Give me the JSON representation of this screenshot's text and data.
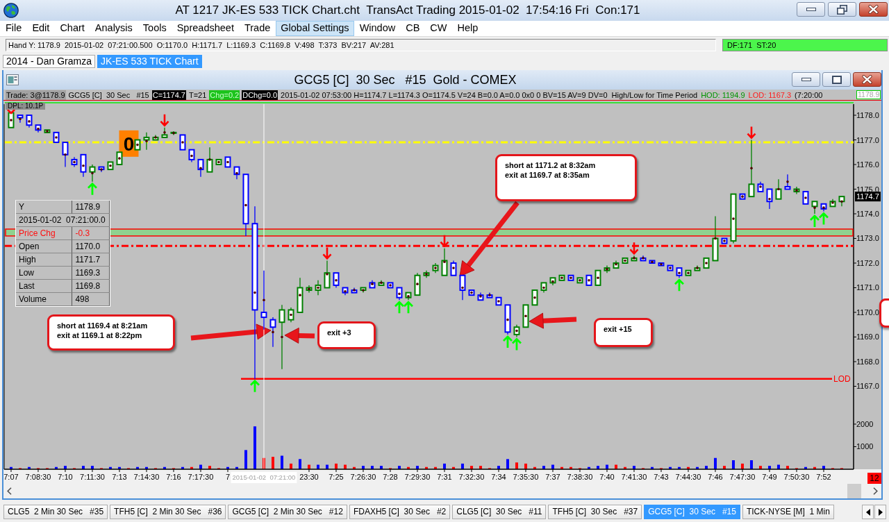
{
  "window": {
    "title": "AT 1217 JK-ES 533 TICK Chart.cht  TransAct Trading 2015-01-02  17:54:16 Fri  Con:171"
  },
  "menu": [
    {
      "label": "File",
      "selected": false
    },
    {
      "label": "Edit",
      "selected": false
    },
    {
      "label": "Chart",
      "selected": false
    },
    {
      "label": "Analysis",
      "selected": false
    },
    {
      "label": "Tools",
      "selected": false
    },
    {
      "label": "Spreadsheet",
      "selected": false
    },
    {
      "label": "Trade",
      "selected": false
    },
    {
      "label": "Global Settings",
      "selected": true
    },
    {
      "label": "Window",
      "selected": false
    },
    {
      "label": "CB",
      "selected": false
    },
    {
      "label": "CW",
      "selected": false
    },
    {
      "label": "Help",
      "selected": false
    }
  ],
  "quote_bar": {
    "text": "Hand Y: 1178.9  2015-01-02  07:21:00.500  O:1170.0  H:1171.7  L:1169.3  C:1169.8  V:498  T:373  BV:217  AV:281",
    "status": "DF:171  ST:20"
  },
  "workspace_tabs": [
    {
      "label": "2014 - Dan Gramza",
      "selected": false
    },
    {
      "label": "JK-ES 533 TICK Chart",
      "selected": true
    }
  ],
  "chart_window": {
    "title": "GCG5 [C]  30 Sec   #15  Gold - COMEX",
    "readouts": [
      {
        "text": "Trade: 3@1178.9",
        "kind": "muted"
      },
      {
        "text": "GCG5 [C]  30 Sec   #15",
        "kind": "plain"
      },
      {
        "text": "C=1174.7",
        "kind": "inverse"
      },
      {
        "text": "T=21",
        "kind": "plain"
      },
      {
        "text": "Chg=0.2",
        "kind": "up"
      },
      {
        "text": "DChg=0.0",
        "kind": "inverse"
      },
      {
        "text": "2015-01-02 07:53:00 H=1174.7 L=1174.3 O=1174.5 V=24 B=0.0 A=0.0 0x0 0 BV=15 AV=9 DV=0  High/Low for Time Period",
        "kind": "plain"
      },
      {
        "text": "HOD: 1194.9",
        "kind": "high"
      },
      {
        "text": "LOD: 1167.3",
        "kind": "low"
      },
      {
        "text": "(7:20:00",
        "kind": "plain"
      }
    ],
    "cursor_price": "1178.9",
    "dpl_label": "DPL: 10.1P",
    "price_chart": {
      "chart_data": {
        "type": "candlestick",
        "ylim": [
          1165.915,
          1178.451
        ],
        "yticks": [
          {
            "value": 1167,
            "label": "1167.0"
          },
          {
            "value": 1168,
            "label": "1168.0"
          },
          {
            "value": 1169,
            "label": "1169.0"
          },
          {
            "value": 1170,
            "label": "1170.0"
          },
          {
            "value": 1171,
            "label": "1171.0"
          },
          {
            "value": 1172,
            "label": "1172.0"
          },
          {
            "value": 1173,
            "label": "1173.0"
          },
          {
            "value": 1174,
            "label": "1174.0"
          },
          {
            "value": 1175,
            "label": "1175.0"
          },
          {
            "value": 1176,
            "label": "1176.0"
          },
          {
            "value": 1177,
            "label": "1177.0"
          },
          {
            "value": 1178,
            "label": "1178.0"
          }
        ],
        "ohlc": [
          [
            1177.5,
            1178.1,
            1177.5,
            1178.1
          ],
          [
            1178.0,
            1178.0,
            1177.7,
            1177.9
          ],
          [
            1178.0,
            1178.0,
            1177.5,
            1177.6
          ],
          [
            1177.6,
            1177.6,
            1177.3,
            1177.4
          ],
          [
            1177.3,
            1177.4,
            1177.3,
            1177.4
          ],
          [
            1177.3,
            1177.3,
            1176.9,
            1176.9
          ],
          [
            1176.9,
            1176.9,
            1175.9,
            1176.4
          ],
          [
            1176.2,
            1176.3,
            1175.9,
            1176.0
          ],
          [
            1176.4,
            1176.4,
            1175.5,
            1175.7
          ],
          [
            1175.7,
            1176.0,
            1175.3,
            1175.9
          ],
          [
            1175.9,
            1175.9,
            1175.7,
            1175.8
          ],
          [
            1175.8,
            1176.1,
            1175.8,
            1176.1
          ],
          [
            1176.0,
            1176.5,
            1176.0,
            1176.5
          ],
          null,
          [
            1176.6,
            1177.0,
            1176.6,
            1177.0
          ],
          [
            1177.0,
            1177.3,
            1176.6,
            1177.1
          ],
          [
            1177.0,
            1177.2,
            1177.0,
            1177.1
          ],
          [
            1177.1,
            1177.5,
            1177.1,
            1177.2
          ],
          [
            1177.3,
            1177.35,
            1177.2,
            1177.3
          ],
          [
            1177.2,
            1177.2,
            1176.6,
            1176.6
          ],
          [
            1176.6,
            1176.6,
            1176.1,
            1176.2
          ],
          [
            1176.2,
            1176.2,
            1175.5,
            1175.8
          ],
          [
            1175.7,
            1176.7,
            1175.7,
            1176.2
          ],
          [
            1176.0,
            1176.2,
            1176.0,
            1176.2
          ],
          [
            1176.3,
            1176.3,
            1175.9,
            1175.9
          ],
          [
            1175.9,
            1175.9,
            1175.4,
            1175.6
          ],
          [
            1175.6,
            1175.6,
            1173.1,
            1173.6
          ],
          [
            1173.6,
            1174.3,
            1167.3,
            1170.1
          ],
          [
            1170.0,
            1171.7,
            1169.3,
            1169.8
          ],
          [
            1169.7,
            1169.8,
            1168.6,
            1169.4
          ],
          [
            1169.6,
            1170.3,
            1167.7,
            1170.1
          ],
          [
            1169.7,
            1170.2,
            1169.6,
            1170.1
          ],
          [
            1170.0,
            1171.4,
            1170.0,
            1171.0
          ],
          [
            1170.9,
            1171.1,
            1170.8,
            1171.0
          ],
          [
            1170.9,
            1171.3,
            1170.7,
            1171.1
          ],
          [
            1171.0,
            1172.1,
            1171.0,
            1171.6
          ],
          [
            1171.6,
            1171.6,
            1171.0,
            1171.1
          ],
          [
            1171.0,
            1171.0,
            1170.7,
            1170.8
          ],
          [
            1170.9,
            1171.0,
            1170.8,
            1170.8
          ],
          [
            1170.9,
            1171.0,
            1170.8,
            1171.0
          ],
          [
            1171.2,
            1171.3,
            1171.0,
            1171.0
          ],
          [
            1171.1,
            1171.3,
            1171.1,
            1171.2
          ],
          [
            1171.2,
            1171.2,
            1171.0,
            1171.0
          ],
          [
            1171.0,
            1171.0,
            1170.5,
            1170.6
          ],
          [
            1170.6,
            1170.8,
            1170.5,
            1170.8
          ],
          [
            1170.7,
            1171.6,
            1170.7,
            1171.5
          ],
          [
            1171.5,
            1171.7,
            1171.4,
            1171.6
          ],
          [
            1171.7,
            1172.0,
            1171.6,
            1171.9
          ],
          [
            1171.5,
            1172.6,
            1171.5,
            1172.1
          ],
          [
            1172.0,
            1172.1,
            1171.5,
            1171.5
          ],
          [
            1171.5,
            1171.5,
            1170.5,
            1170.9
          ],
          [
            1170.9,
            1170.9,
            1170.7,
            1170.7
          ],
          [
            1170.7,
            1170.8,
            1170.5,
            1170.5
          ],
          [
            1170.7,
            1170.8,
            1170.6,
            1170.6
          ],
          [
            1170.6,
            1170.6,
            1170.3,
            1170.3
          ],
          [
            1170.3,
            1170.3,
            1169.1,
            1169.2
          ],
          [
            1169.1,
            1169.5,
            1169.0,
            1169.4
          ],
          [
            1169.4,
            1170.3,
            1169.4,
            1170.3
          ],
          [
            1170.3,
            1170.9,
            1170.3,
            1170.9
          ],
          [
            1170.9,
            1171.2,
            1170.8,
            1171.2
          ],
          [
            1171.2,
            1171.4,
            1171.1,
            1171.4
          ],
          [
            1171.3,
            1171.5,
            1171.3,
            1171.5
          ],
          [
            1171.5,
            1171.5,
            1171.3,
            1171.3
          ],
          [
            1171.2,
            1171.4,
            1171.2,
            1171.4
          ],
          [
            1171.5,
            1171.5,
            1171.1,
            1171.1
          ],
          [
            1171.1,
            1171.7,
            1171.1,
            1171.7
          ],
          [
            1171.7,
            1171.9,
            1171.6,
            1171.8
          ],
          [
            1171.8,
            1172.1,
            1171.8,
            1172.0
          ],
          [
            1172.0,
            1172.2,
            1172.0,
            1172.2
          ],
          [
            1172.1,
            1172.3,
            1172.1,
            1172.2
          ],
          [
            1172.2,
            1172.3,
            1172.1,
            1172.1
          ],
          [
            1172.1,
            1172.1,
            1172.0,
            1172.0
          ],
          [
            1172.0,
            1172.0,
            1171.9,
            1171.9
          ],
          [
            1171.9,
            1171.9,
            1171.7,
            1171.7
          ],
          [
            1171.8,
            1171.8,
            1171.4,
            1171.5
          ],
          [
            1171.5,
            1171.7,
            1171.5,
            1171.7
          ],
          [
            1171.7,
            1171.9,
            1171.7,
            1171.8
          ],
          [
            1171.8,
            1172.2,
            1171.8,
            1172.2
          ],
          [
            1172.1,
            1173.9,
            1172.1,
            1173.0
          ],
          [
            1173.0,
            1173.0,
            1172.8,
            1172.8
          ],
          [
            1172.9,
            1174.8,
            1172.8,
            1174.8
          ],
          [
            1174.8,
            1174.8,
            1174.6,
            1174.6
          ],
          [
            1174.7,
            1177.0,
            1174.7,
            1175.2
          ],
          [
            1175.2,
            1175.3,
            1174.9,
            1174.9
          ],
          [
            1175.0,
            1175.0,
            1174.2,
            1174.5
          ],
          [
            1174.6,
            1175.4,
            1174.6,
            1175.0
          ],
          [
            1175.1,
            1175.6,
            1175.0,
            1175.0
          ],
          [
            1174.9,
            1175.1,
            1174.8,
            1175.0
          ],
          [
            1174.9,
            1174.9,
            1174.4,
            1174.4
          ],
          [
            1174.3,
            1174.5,
            1174.0,
            1174.5
          ],
          [
            1174.4,
            1174.4,
            1174.1,
            1174.2
          ],
          [
            1174.3,
            1174.6,
            1174.3,
            1174.5
          ],
          [
            1174.5,
            1174.7,
            1174.3,
            1174.7
          ]
        ],
        "ref_lines": [
          {
            "axis": "y",
            "value": 1176.9,
            "color": "#ffff00"
          },
          {
            "axis": "y",
            "value": 1172.7,
            "color": "#ff0000"
          },
          {
            "axis": "y",
            "value": 1167.3,
            "color": "#ff0000",
            "label": "LOD"
          }
        ],
        "bands": [
          {
            "axis": "y",
            "from": 1173.1,
            "to": 1173.38,
            "color": "#8fd18f"
          }
        ],
        "annotations": [
          {
            "text": "0",
            "y": 1176.85
          }
        ]
      },
      "last_price_label": "1174.7",
      "callouts": [
        {
          "lines": [
            "short at 1169.4 at 8:21am",
            "exit at 1169.1 at 8:22pm"
          ],
          "clipped": false
        },
        {
          "lines": [
            "exit +3"
          ],
          "clipped": false
        },
        {
          "lines": [
            "short at 1171.2 at 8:32am",
            "exit at 1169.7 at 8:35am"
          ],
          "clipped": false
        },
        {
          "lines": [
            "exit +15"
          ],
          "clipped": false
        },
        {
          "clipped": true
        }
      ]
    },
    "data_window": [
      {
        "kind": "field",
        "label": "Y",
        "value": "1178.9"
      },
      {
        "kind": "timestamp",
        "value": "2015-01-02  07:21:00.0"
      },
      {
        "kind": "change",
        "label": "Price Chg",
        "value": "-0.3"
      },
      {
        "kind": "field",
        "label": "Open",
        "value": "1170.0"
      },
      {
        "kind": "field",
        "label": "High",
        "value": "1171.7"
      },
      {
        "kind": "field",
        "label": "Low",
        "value": "1169.3"
      },
      {
        "kind": "field",
        "label": "Last",
        "value": "1169.8"
      },
      {
        "kind": "field",
        "label": "Volume",
        "value": "498"
      }
    ],
    "volume_chart": {
      "chart_data": {
        "type": "bar",
        "categories": [
          "7:07",
          null,
          null,
          "7:08:30",
          null,
          null,
          "7:10",
          null,
          null,
          "7:11:30",
          null,
          null,
          "7:13",
          null,
          null,
          "7:14:30",
          null,
          null,
          "7:16",
          null,
          null,
          "7:17:30",
          null,
          null,
          "7",
          null,
          null,
          null,
          null,
          null,
          null,
          null,
          null,
          "23:30",
          null,
          null,
          "7:25",
          null,
          null,
          "7:26:30",
          null,
          null,
          "7:28",
          null,
          null,
          "7:29:30",
          null,
          null,
          "7:31",
          null,
          null,
          "7:32:30",
          null,
          null,
          "7:34",
          null,
          null,
          "7:35:30",
          null,
          null,
          "7:37",
          null,
          null,
          "7:38:30",
          null,
          null,
          "7:40",
          null,
          null,
          "7:41:30",
          null,
          null,
          "7:43",
          null,
          null,
          "7:44:30",
          null,
          null,
          "7:46",
          null,
          null,
          "7:47:30",
          null,
          null,
          "7:49",
          null,
          null,
          "7:50:30",
          null,
          null,
          "7:52",
          null,
          null
        ],
        "ylim": [
          0,
          2492
        ],
        "yticks": [
          {
            "value": 1000,
            "label": "1000"
          },
          {
            "value": 2000,
            "label": "2000"
          }
        ],
        "series": [
          {
            "color": "#0000ff",
            "values": [
              100,
              null,
              100,
              null,
              null,
              100,
              150,
              null,
              150,
              150,
              null,
              100,
              100,
              null,
              100,
              100,
              null,
              100,
              null,
              100,
              null,
              200,
              null,
              null,
              100,
              100,
              850,
              1900,
              null,
              null,
              600,
              null,
              450,
              null,
              200,
              200,
              null,
              null,
              null,
              150,
              150,
              150,
              null,
              150,
              null,
              150,
              null,
              null,
              250,
              null,
              250,
              null,
              null,
              null,
              150,
              450,
              null,
              null,
              null,
              150,
              200,
              null,
              null,
              null,
              100,
              150,
              200,
              null,
              null,
              150,
              null,
              100,
              null,
              100,
              100,
              null,
              100,
              150,
              500,
              null,
              400,
              null,
              400,
              null,
              150,
              200,
              null,
              null,
              100,
              null,
              150,
              null,
              null
            ]
          },
          {
            "color": "#ff0000",
            "values": [
              null,
              50,
              null,
              50,
              50,
              null,
              null,
              50,
              null,
              null,
              50,
              null,
              null,
              50,
              null,
              null,
              50,
              null,
              50,
              null,
              100,
              null,
              150,
              50,
              null,
              null,
              null,
              null,
              500,
              550,
              null,
              250,
              null,
              200,
              null,
              null,
              250,
              200,
              100,
              null,
              null,
              null,
              50,
              null,
              100,
              null,
              100,
              100,
              null,
              100,
              null,
              150,
              150,
              50,
              null,
              null,
              300,
              250,
              100,
              null,
              null,
              100,
              100,
              50,
              null,
              null,
              null,
              200,
              100,
              null,
              50,
              null,
              50,
              null,
              null,
              100,
              null,
              null,
              null,
              150,
              null,
              250,
              null,
              150,
              null,
              null,
              150,
              50,
              null,
              100,
              null,
              50,
              50
            ]
          }
        ]
      }
    },
    "cursor_time_label": "2015-01-02  07:21:00",
    "count_badge": "12"
  },
  "chart_tabs": [
    {
      "label": "CLG5  2 Min 30 Sec   #35",
      "selected": false
    },
    {
      "label": "TFH5 [C]  2 Min 30 Sec   #36",
      "selected": false
    },
    {
      "label": "GCG5 [C]  2 Min 30 Sec   #12",
      "selected": false
    },
    {
      "label": "FDAXH5 [C]  30 Sec   #2",
      "selected": false
    },
    {
      "label": "CLG5 [C]  30 Sec   #11",
      "selected": false
    },
    {
      "label": "TFH5 [C]  30 Sec   #37",
      "selected": false
    },
    {
      "label": "GCG5 [C]  30 Sec   #15",
      "selected": true
    },
    {
      "label": "TICK-NYSE [M]  1 Min",
      "selected": false
    }
  ]
}
